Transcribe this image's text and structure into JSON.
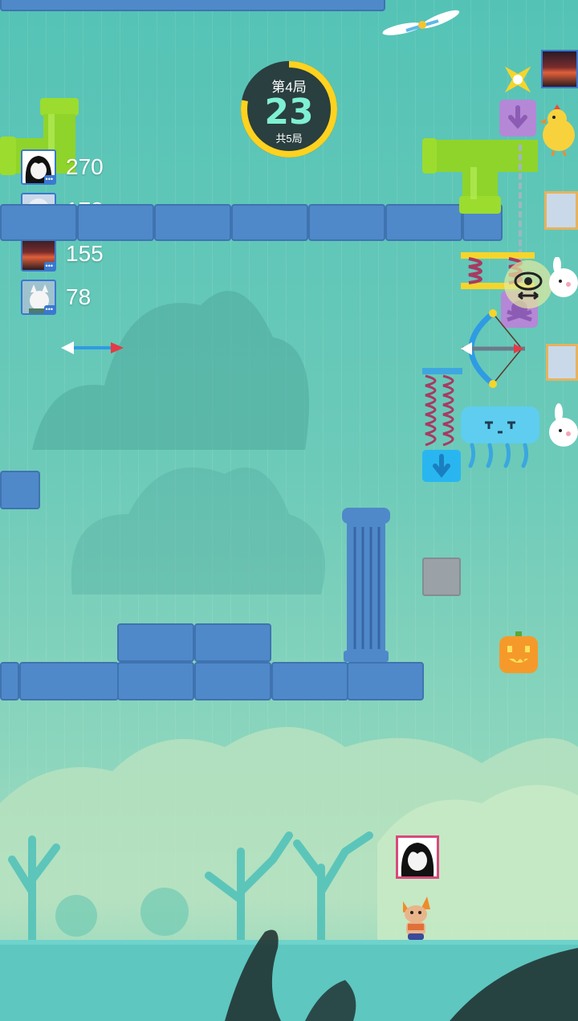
{
  "hud": {
    "round_label": "第4局",
    "timer": "23",
    "total_label": "共5局",
    "timer_progress": 0.78,
    "colors": {
      "ring": "#ffd21f",
      "dial": "#2a3f3f",
      "timer": "#7ff0d4"
    }
  },
  "scoreboard": [
    {
      "score": "270",
      "avatar": "avatar-dark-hair"
    },
    {
      "score": "178",
      "avatar": "avatar-silver-hair"
    },
    {
      "score": "155",
      "avatar": "avatar-sunset"
    },
    {
      "score": "78",
      "avatar": "avatar-white-fox"
    }
  ],
  "player_tag_avatar": "avatar-dark-hair",
  "colors": {
    "water": "#54c3b6",
    "brick": "#4f89c9",
    "pipe": "#8fd42a",
    "spring": "#a83a63",
    "jelly": "#5ecdf0",
    "pumpkin": "#f59a2a"
  }
}
